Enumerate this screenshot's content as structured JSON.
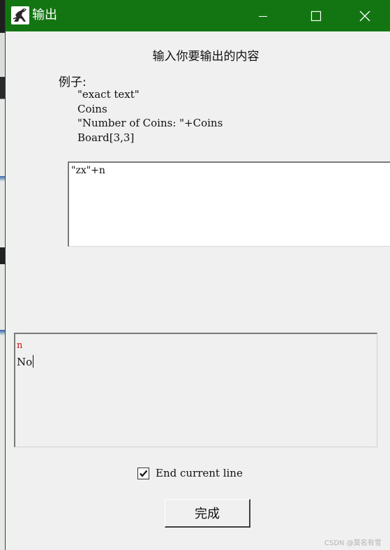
{
  "window": {
    "title": "输出",
    "titlebar_color": "#127512",
    "icon": "app-dinosaur-icon",
    "controls": [
      "minimize-icon",
      "maximize-icon",
      "close-icon"
    ]
  },
  "dialog": {
    "heading": "输入你要输出的内容",
    "examples_label": "例子:",
    "examples": [
      "\"exact text\"",
      "Coins",
      "\"Number of Coins: \"+Coins",
      "Board[3,3]"
    ]
  },
  "input": {
    "value": "\"zx\"+n"
  },
  "output": {
    "variable": "n",
    "variable_color": "#d01010",
    "text": "No"
  },
  "options": {
    "end_current_line": {
      "label": "End current line",
      "checked": true
    }
  },
  "buttons": {
    "done": "完成"
  },
  "watermark": "CSDN @莫名有雪"
}
